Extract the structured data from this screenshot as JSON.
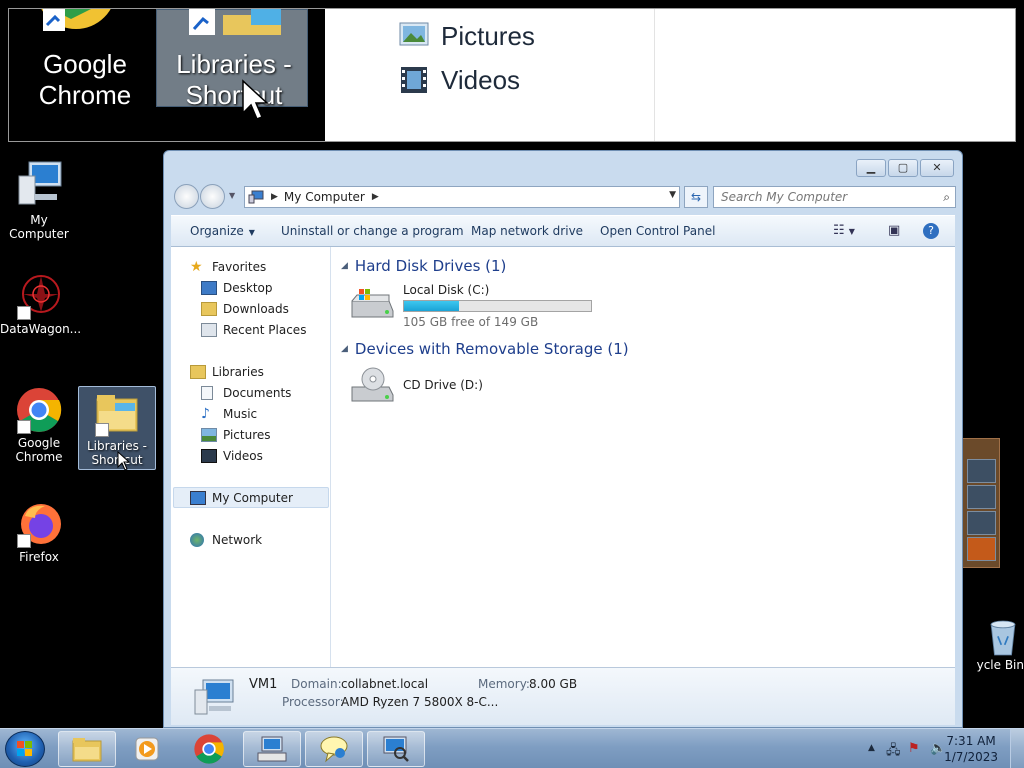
{
  "zoom": {
    "desktop_labels": [
      "Google\nChrome",
      "Libraries -\nShortcut"
    ],
    "nav_items": [
      "Pictures",
      "Videos"
    ]
  },
  "desktop": {
    "icons": [
      {
        "label": "My Computer"
      },
      {
        "label": "DataWagon..."
      },
      {
        "label": "Google Chrome"
      },
      {
        "label": "Libraries - Shortcut"
      },
      {
        "label": "Firefox"
      }
    ],
    "recycle_bin_label": "ycle Bin"
  },
  "window": {
    "address": {
      "crumb": "My Computer"
    },
    "search_placeholder": "Search My Computer",
    "toolbar": {
      "organize": "Organize",
      "uninstall": "Uninstall or change a program",
      "map_drive": "Map network drive",
      "control_panel": "Open Control Panel"
    },
    "nav": {
      "favorites": "Favorites",
      "desktop": "Desktop",
      "downloads": "Downloads",
      "recent": "Recent Places",
      "libraries": "Libraries",
      "documents": "Documents",
      "music": "Music",
      "pictures": "Pictures",
      "videos": "Videos",
      "my_computer": "My Computer",
      "network": "Network"
    },
    "groups": {
      "hdd": "Hard Disk Drives (1)",
      "removable": "Devices with Removable Storage (1)"
    },
    "drives": {
      "c_name": "Local Disk (C:)",
      "c_free": "105 GB free of 149 GB",
      "c_used_fraction": 0.295,
      "d_name": "CD Drive (D:)"
    },
    "details": {
      "name": "VM1",
      "domain_label": "Domain:",
      "domain_value": "collabnet.local",
      "memory_label": "Memory:",
      "memory_value": "8.00 GB",
      "processor_label": "Processor:",
      "processor_value": "AMD Ryzen 7 5800X 8-C..."
    }
  },
  "taskbar": {
    "time": "7:31 AM",
    "date": "1/7/2023"
  },
  "colors": {
    "progress": "#1aa3d6",
    "group_heading": "#1e3e8c",
    "taskbar": "#7f9ec2"
  }
}
